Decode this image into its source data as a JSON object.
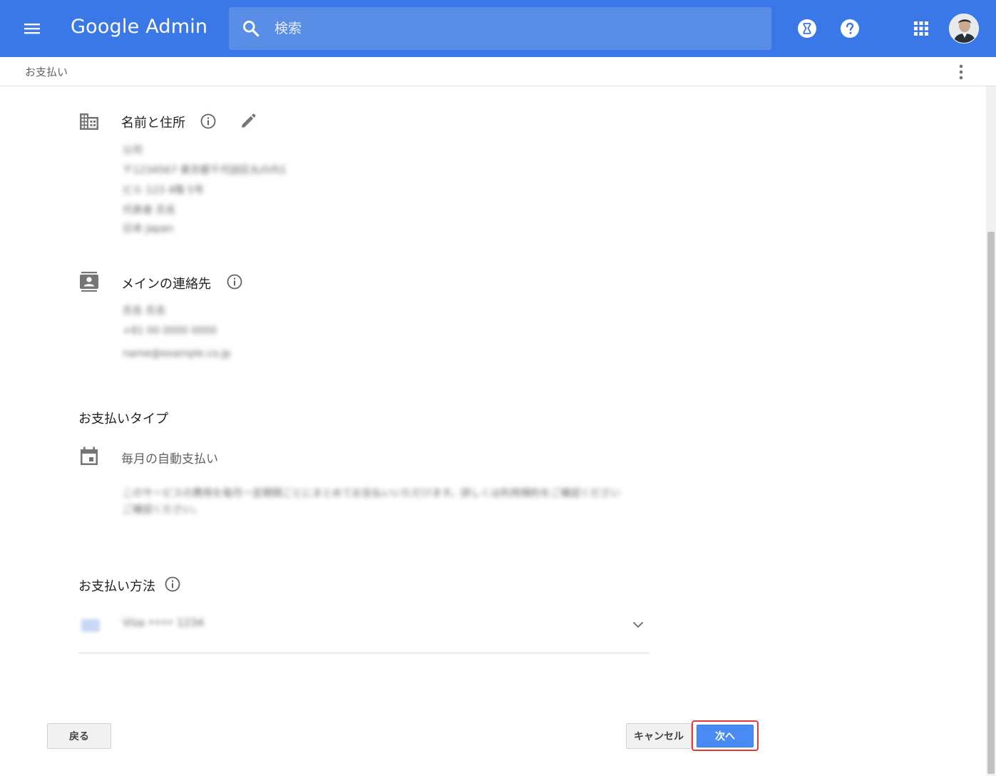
{
  "header": {
    "logo_text": "Google Admin",
    "search_placeholder": "検索",
    "colors": {
      "bar": "#3b78e7",
      "search_bg": "#5a8ee6"
    },
    "icons": [
      "menu-icon",
      "search-icon",
      "hourglass-icon",
      "help-icon",
      "apps-grid-icon",
      "avatar"
    ]
  },
  "breadcrumb": {
    "title": "お支払い"
  },
  "sections": {
    "name_address": {
      "title": "名前と住所",
      "blurred_lines": [
        "公司",
        "〒1234567 東京都千代田区丸の内1",
        "ビル 123 4階 5号",
        "代表者 氏名",
        "日本 Japan"
      ]
    },
    "main_contact": {
      "title": "メインの連絡先",
      "blurred_lines": [
        "氏名 氏名",
        "+81 00 0000 0000",
        "name@example.co.jp"
      ]
    },
    "payment_type": {
      "heading": "お支払いタイプ",
      "label": "毎月の自動支払い",
      "blurred_text": [
        "このサービスの費用を毎月一定期間ごとにまとめてお支払いいただけます。詳しくは利用規約をご確認ください",
        "ご確認ください。"
      ]
    },
    "payment_method": {
      "heading": "お支払い方法",
      "blurred_value": "Visa •••• 1234"
    }
  },
  "buttons": {
    "back": "戻る",
    "cancel": "キャンセル",
    "next": "次へ"
  }
}
